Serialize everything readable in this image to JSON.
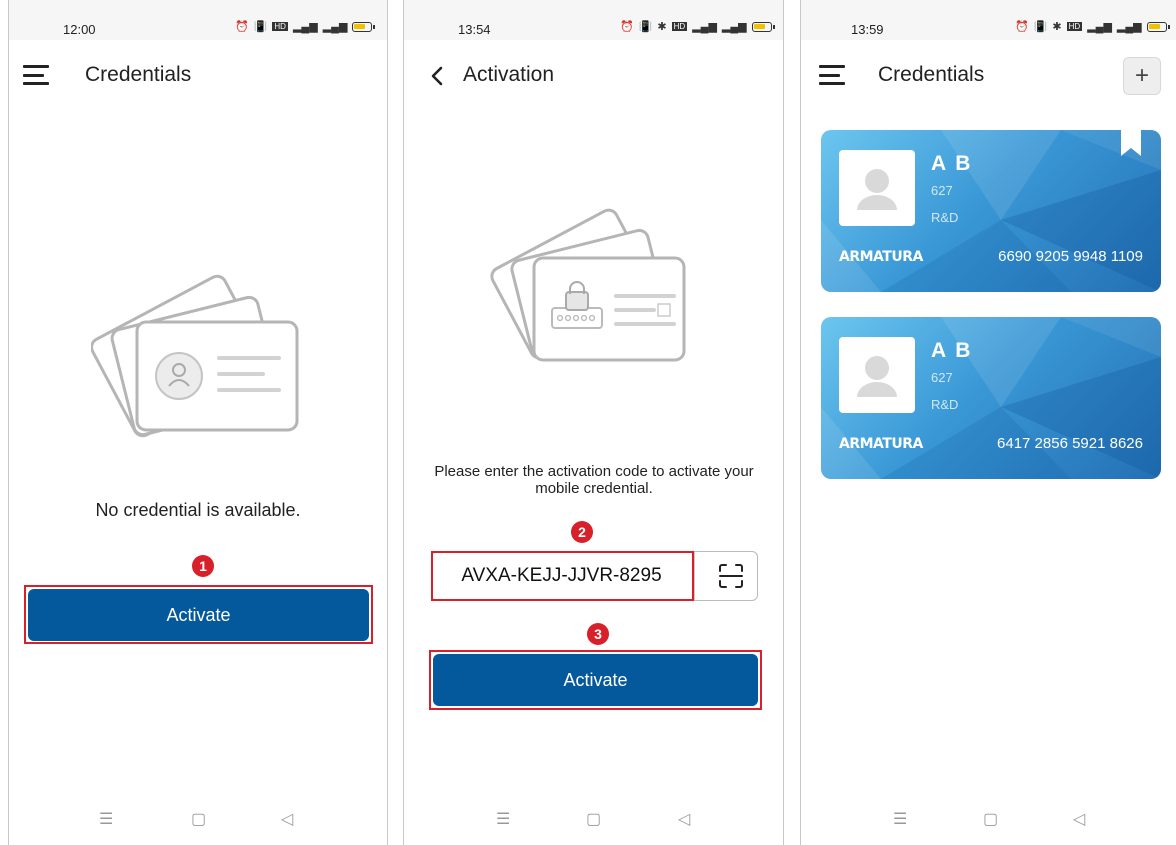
{
  "screen1": {
    "status_time": "12:00",
    "title": "Credentials",
    "empty_message": "No credential is available.",
    "step_number": "1",
    "activate_label": "Activate"
  },
  "screen2": {
    "status_time": "13:54",
    "title": "Activation",
    "instruction": "Please enter the activation code to activate your mobile credential.",
    "step2_number": "2",
    "step3_number": "3",
    "code_value": "AVXA-KEJJ-JJVR-8295",
    "activate_label": "Activate"
  },
  "screen3": {
    "status_time": "13:59",
    "title": "Credentials",
    "add_label": "+",
    "cards": [
      {
        "name": "A B",
        "id": "627",
        "dept": "R&D",
        "brand": "ARMATURA",
        "card_number": "6690 9205 9948 1109",
        "bookmarked": true
      },
      {
        "name": "A B",
        "id": "627",
        "dept": "R&D",
        "brand": "ARMATURA",
        "card_number": "6417 2856 5921 8626",
        "bookmarked": false
      }
    ]
  },
  "status_icons": [
    "alarm-icon",
    "vibrate-icon",
    "bluetooth-icon",
    "hd-icon",
    "signal-icon",
    "signal-icon",
    "battery-icon"
  ],
  "nav_buttons": [
    "menu-nav-icon",
    "home-nav-icon",
    "back-nav-icon"
  ],
  "colors": {
    "primary": "#04589c",
    "highlight": "#d8202a",
    "card_light": "#6cc6ef",
    "card_dark": "#2370b4"
  }
}
